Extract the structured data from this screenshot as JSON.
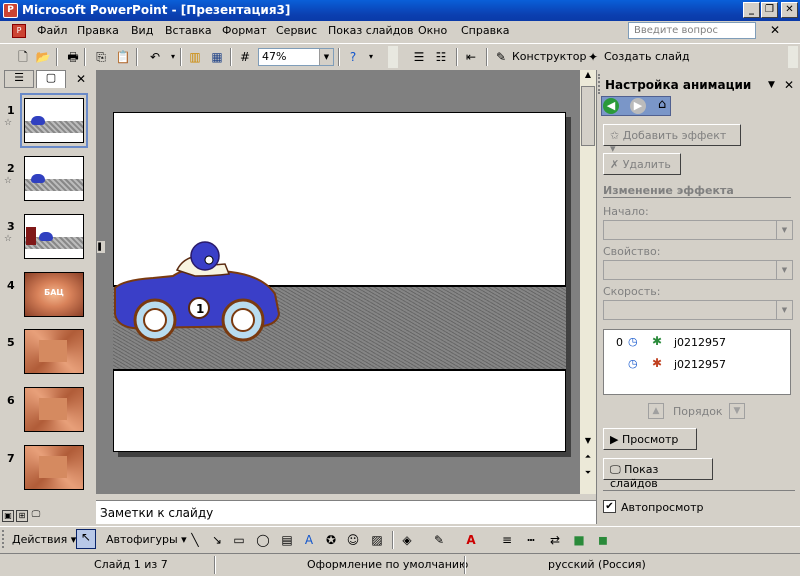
{
  "window": {
    "title": "Microsoft PowerPoint - [Презентация3]"
  },
  "menu": {
    "items": [
      "Файл",
      "Правка",
      "Вид",
      "Вставка",
      "Формат",
      "Сервис",
      "Показ слайдов",
      "Окно",
      "Справка"
    ],
    "ask_placeholder": "Введите вопрос"
  },
  "toolbar": {
    "zoom": "47%",
    "design_label": "Конструктор",
    "new_slide_label": "Создать слайд"
  },
  "slides": {
    "numbers": [
      "1",
      "2",
      "3",
      "4",
      "5",
      "6",
      "7"
    ],
    "thumb4_text": "БАЦ"
  },
  "notes": {
    "placeholder": "Заметки к слайду"
  },
  "animation_pane": {
    "title": "Настройка анимации",
    "add_effect_label": "Добавить эффект",
    "delete_label": "Удалить",
    "modify_heading": "Изменение эффекта",
    "start_label": "Начало:",
    "property_label": "Свойство:",
    "speed_label": "Скорость:",
    "list": [
      {
        "index": "0",
        "name": "j0212957"
      },
      {
        "index": "",
        "name": "j0212957"
      }
    ],
    "order_label": "Порядок",
    "preview_label": "Просмотр",
    "slideshow_label": "Показ слайдов",
    "autopreview_label": "Автопросмотр",
    "autopreview_checked": true
  },
  "drawing": {
    "actions_label": "Действия",
    "autoshapes_label": "Автофигуры"
  },
  "status": {
    "slide_info": "Слайд 1 из 7",
    "design": "Оформление по умолчанию",
    "language": "русский (Россия)"
  }
}
